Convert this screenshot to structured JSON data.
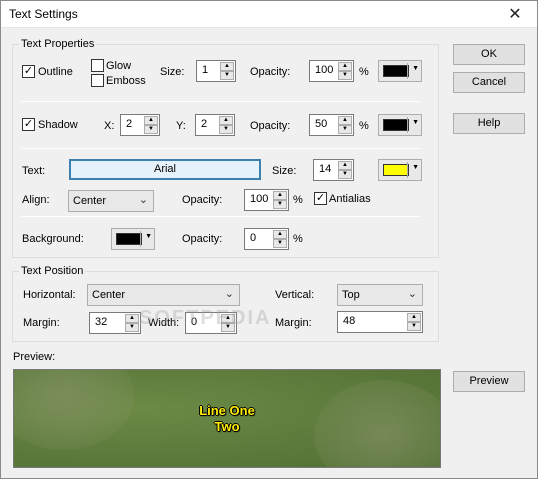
{
  "window": {
    "title": "Text Settings",
    "close_glyph": "✕"
  },
  "text_properties": {
    "group_label": "Text Properties",
    "outline_label": "Outline",
    "glow_label": "Glow",
    "emboss_label": "Emboss",
    "size_label": "Size:",
    "size_value": "1",
    "opacity_label": "Opacity:",
    "opacity_value": "100",
    "percent": "%",
    "outline_color": "#000000"
  },
  "shadow": {
    "label": "Shadow",
    "x_label": "X:",
    "x_value": "2",
    "y_label": "Y:",
    "y_value": "2",
    "opacity_label": "Opacity:",
    "opacity_value": "50",
    "percent": "%",
    "color": "#000000"
  },
  "text": {
    "text_label": "Text:",
    "font_name": "Arial",
    "size_label": "Size:",
    "size_value": "14",
    "color": "#ffff00",
    "align_label": "Align:",
    "align_value": "Center",
    "opacity_label": "Opacity:",
    "opacity_value": "100",
    "percent": "%",
    "antialias_label": "Antialias"
  },
  "background": {
    "label": "Background:",
    "color": "#000000",
    "opacity_label": "Opacity:",
    "opacity_value": "0",
    "percent": "%"
  },
  "text_position": {
    "group_label": "Text Position",
    "horizontal_label": "Horizontal:",
    "horizontal_value": "Center",
    "vertical_label": "Vertical:",
    "vertical_value": "Top",
    "margin_label": "Margin:",
    "margin_value": "32",
    "width_label": "Width:",
    "width_value": "0",
    "margin2_label": "Margin:",
    "margin2_value": "48"
  },
  "buttons": {
    "ok": "OK",
    "cancel": "Cancel",
    "help": "Help",
    "preview": "Preview"
  },
  "preview": {
    "label": "Preview:",
    "line1": "Line One",
    "line2": "Two"
  },
  "watermark": "SOFTPEDIA"
}
